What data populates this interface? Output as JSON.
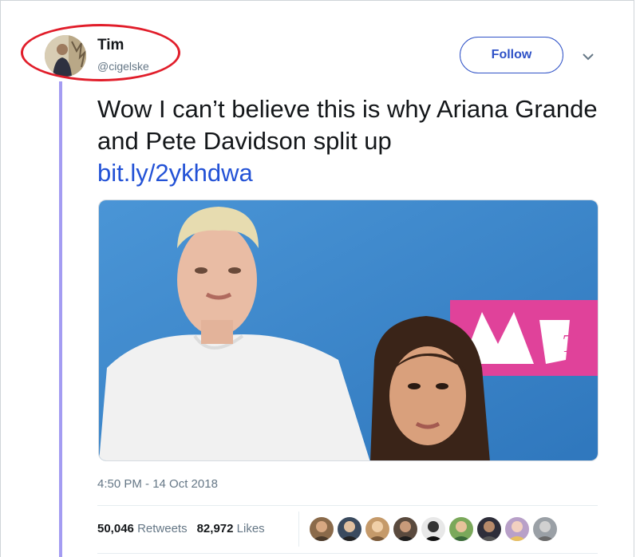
{
  "user": {
    "display_name": "Tim",
    "handle": "@cigelske"
  },
  "follow_label": "Follow",
  "tweet": {
    "text": "Wow I can’t believe this is why Ariana Grande and Pete Davidson split up",
    "link": "bit.ly/2ykhdwa"
  },
  "timestamp": "4:50 PM - 14 Oct 2018",
  "stats": {
    "retweets_count": "50,046",
    "retweets_label": "Retweets",
    "likes_count": "82,972",
    "likes_label": "Likes"
  },
  "media": {
    "backdrop_color": "#3a86c8",
    "logo_color": "#e0429a"
  },
  "colors": {
    "follow_accent": "#2f52c7",
    "link": "#2352d6",
    "thread_line": "#a49cf2",
    "annotation_circle": "#e11d2a"
  },
  "likers_count_shown": 9
}
